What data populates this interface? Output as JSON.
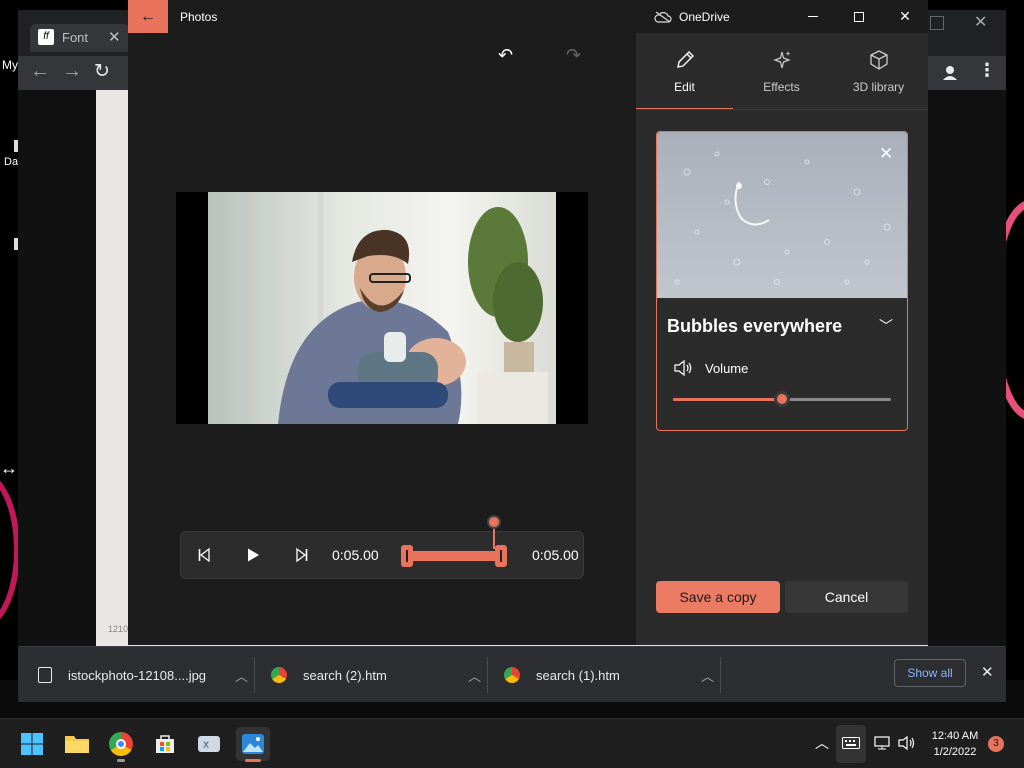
{
  "desktop": {
    "label_my": "My",
    "label_da": "Da"
  },
  "chrome": {
    "tab_title": "Font",
    "downloads": [
      {
        "name": "istockphoto-12108....jpg"
      },
      {
        "name": "search (2).htm"
      },
      {
        "name": "search (1).htm"
      }
    ],
    "show_all": "Show all",
    "page_watermark": "1210"
  },
  "photos": {
    "title": "Photos",
    "onedrive": "OneDrive",
    "tabs": [
      {
        "label": "Edit",
        "icon": "pencil-icon",
        "active": true
      },
      {
        "label": "Effects",
        "icon": "sparkle-icon",
        "active": false
      },
      {
        "label": "3D library",
        "icon": "cube-icon",
        "active": false
      }
    ],
    "effect_card": {
      "title": "Bubbles everywhere",
      "volume_label": "Volume",
      "volume_level": 0.5
    },
    "playback": {
      "time_current": "0:05.00",
      "time_total": "0:05.00"
    },
    "save_label": "Save a copy",
    "cancel_label": "Cancel",
    "accent": "#e9735c"
  },
  "taskbar": {
    "time": "12:40 AM",
    "date": "1/2/2022",
    "notifications": "3"
  }
}
